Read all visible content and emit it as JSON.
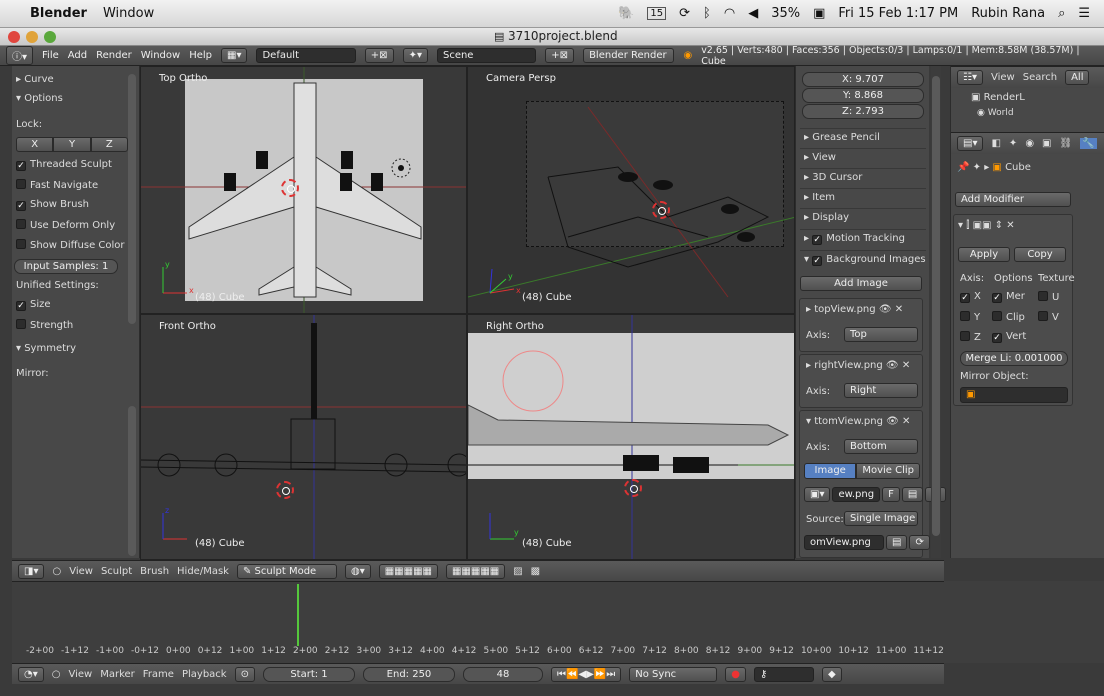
{
  "macbar": {
    "app": "Blender",
    "menu": "Window",
    "status": [
      "15",
      "35%",
      "Fri 15 Feb  1:17 PM",
      "Rubin Rana"
    ]
  },
  "window": {
    "title": "3710project.blend"
  },
  "infobar": {
    "menus": [
      "File",
      "Add",
      "Render",
      "Window",
      "Help"
    ],
    "layout": "Default",
    "scene": "Scene",
    "engine": "Blender Render",
    "stats": "v2.65 | Verts:480 | Faces:356 | Objects:0/3 | Lamps:0/1 | Mem:8.58M (38.57M) | Cube"
  },
  "toolshelf": {
    "curve": "Curve",
    "options": "Options",
    "lock": "Lock:",
    "axes": [
      "X",
      "Y",
      "Z"
    ],
    "checks": [
      {
        "label": "Threaded Sculpt",
        "on": true
      },
      {
        "label": "Fast Navigate",
        "on": false
      },
      {
        "label": "Show Brush",
        "on": true
      },
      {
        "label": "Use Deform Only",
        "on": false
      },
      {
        "label": "Show Diffuse Color",
        "on": false
      }
    ],
    "input_samples": "Input Samples: 1",
    "unified": "Unified Settings:",
    "size": "Size",
    "strength": "Strength",
    "symmetry": "Symmetry",
    "mirror": "Mirror:"
  },
  "viewports": {
    "top": "Top Ortho",
    "camera": "Camera Persp",
    "front": "Front Ortho",
    "right": "Right Ortho",
    "cube": "(48) Cube"
  },
  "npanel": {
    "x": "X: 9.707",
    "y": "Y: 8.868",
    "z": "Z: 2.793",
    "sections": [
      "Grease Pencil",
      "View",
      "3D Cursor",
      "Item",
      "Display",
      "Motion Tracking",
      "Background Images"
    ],
    "add_image": "Add Image",
    "images": [
      {
        "name": "topView.png",
        "axis": "Top"
      },
      {
        "name": "rightView.png",
        "axis": "Right"
      },
      {
        "name": "ttomView.png",
        "axis": "Bottom"
      }
    ],
    "axis_label": "Axis:",
    "image_tab": "Image",
    "movieclip_tab": "Movie Clip",
    "file_short": "ew.png",
    "file_f": "F",
    "source_label": "Source:",
    "source_value": "Single Image",
    "file_path": "omView.png"
  },
  "props": {
    "outliner_view": "View",
    "outliner_search": "Search",
    "outliner_all": "All",
    "outliner_items": [
      "RenderL",
      "World"
    ],
    "object": "Cube",
    "add_modifier": "Add Modifier",
    "apply": "Apply",
    "copy": "Copy",
    "axis_h": "Axis:",
    "options_h": "Options",
    "texture_h": "Texture",
    "rows": [
      [
        "X",
        "Mer",
        "U"
      ],
      [
        "Y",
        "Clip",
        "V"
      ],
      [
        "Z",
        "Vert",
        ""
      ]
    ],
    "merge": "Merge Li: 0.001000",
    "mirror_obj": "Mirror Object:"
  },
  "viewheader": {
    "items": [
      "View",
      "Sculpt",
      "Brush",
      "Hide/Mask"
    ],
    "mode": "Sculpt Mode"
  },
  "timeline": {
    "ticks": [
      "-2+00",
      "-1+12",
      "-1+00",
      "-0+12",
      "0+00",
      "0+12",
      "1+00",
      "1+12",
      "2+00",
      "2+12",
      "3+00",
      "3+12",
      "4+00",
      "4+12",
      "5+00",
      "5+12",
      "6+00",
      "6+12",
      "7+00",
      "7+12",
      "8+00",
      "8+12",
      "9+00",
      "9+12",
      "10+00",
      "10+12",
      "11+00",
      "11+12"
    ],
    "menus": [
      "View",
      "Marker",
      "Frame",
      "Playback"
    ],
    "start": "Start: 1",
    "end": "End: 250",
    "frame": "48",
    "sync": "No Sync"
  }
}
